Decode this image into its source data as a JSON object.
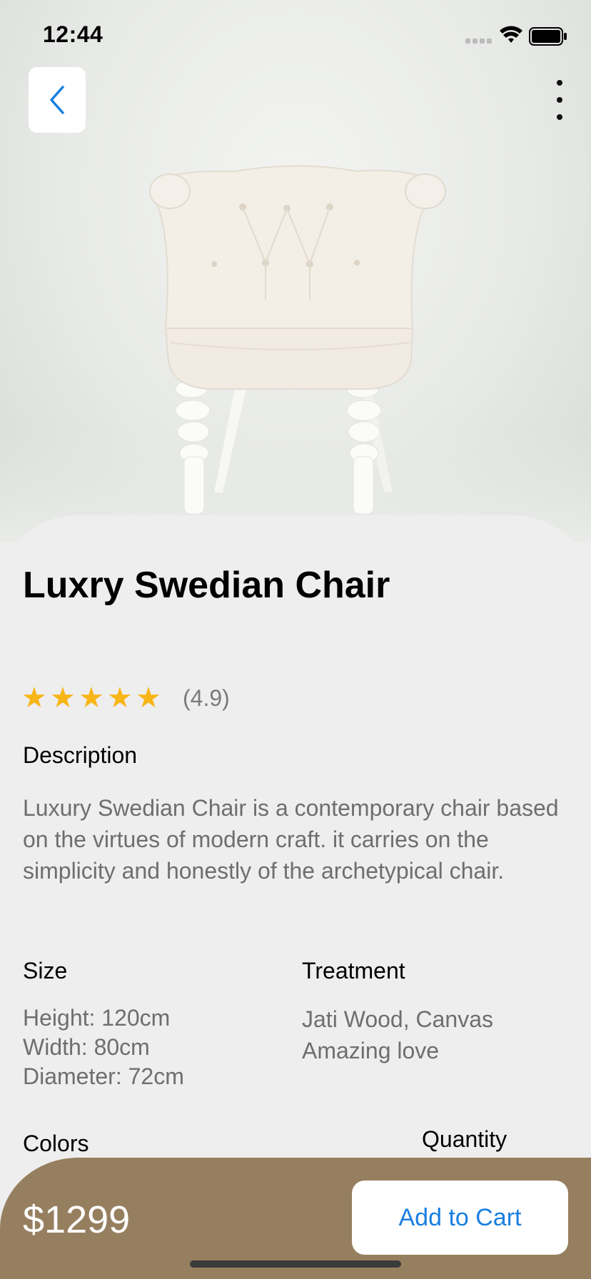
{
  "status_bar": {
    "time": "12:44"
  },
  "icons": {
    "back": "chevron-left-icon",
    "more": "more-vertical-icon",
    "signal": "cellular-signal-icon",
    "wifi": "wifi-icon",
    "battery": "battery-icon",
    "star": "star-icon"
  },
  "colors": {
    "accent": "#1a7fe0",
    "star": "#f8b516",
    "bottom_bar": "#967f5f",
    "background": "#eeeeee"
  },
  "product": {
    "title": "Luxry Swedian Chair",
    "rating_stars": 5,
    "rating_text": "(4.9)",
    "description_heading": "Description",
    "description": "Luxury Swedian Chair is a contemporary chair based on the virtues of modern craft. it carries on the simplicity and honestly of the archetypical chair.",
    "size_heading": "Size",
    "size_lines": [
      "Height: 120cm",
      "Width: 80cm",
      "Diameter: 72cm"
    ],
    "treatment_heading": "Treatment",
    "treatment_lines": [
      "Jati Wood, Canvas",
      "Amazing love"
    ],
    "colors_heading": "Colors",
    "quantity_heading": "Quantity"
  },
  "cart": {
    "price": "$1299",
    "button_label": "Add to Cart"
  }
}
